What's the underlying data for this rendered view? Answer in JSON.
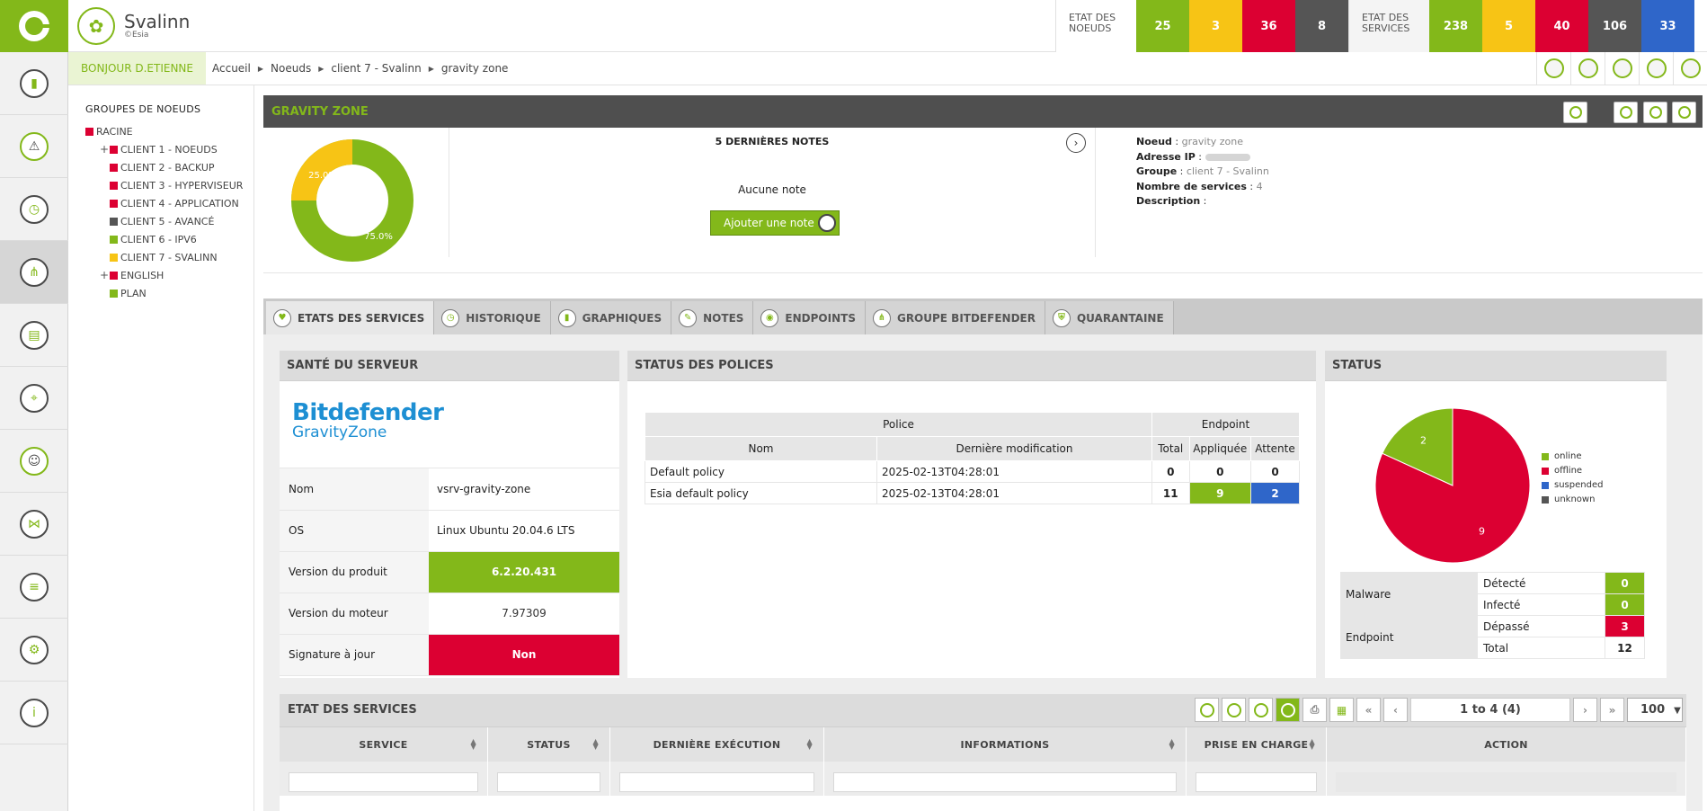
{
  "app": {
    "name": "Svalinn",
    "sub": "©Esia"
  },
  "etat_noeuds": {
    "label": "ETAT DES NOEUDS",
    "counts": [
      "25",
      "3",
      "36",
      "8"
    ]
  },
  "etat_services": {
    "label": "ETAT DES SERVICES",
    "counts": [
      "238",
      "5",
      "40",
      "106",
      "33"
    ]
  },
  "colors": {
    "ok": "#83b81a",
    "warn": "#f7c415",
    "crit": "#dc0032",
    "unknown": "#555555",
    "blue": "#2f66c9"
  },
  "greeting": "BONJOUR D.ETIENNE",
  "breadcrumb": [
    "Accueil",
    "Noeuds",
    "client 7 - Svalinn",
    "gravity zone"
  ],
  "tree": {
    "title": "GROUPES DE NOEUDS",
    "root": "RACINE",
    "items": [
      "CLIENT 1 - NOEUDS",
      "CLIENT 2 - BACKUP",
      "CLIENT 3 - HYPERVISEUR",
      "CLIENT 4 - APPLICATION",
      "CLIENT 5 - AVANCÉ",
      "CLIENT 6 - IPV6",
      "CLIENT 7 - SVALINN",
      "ENGLISH",
      "PLAN"
    ]
  },
  "node": {
    "title": "GRAVITY ZONE",
    "donut": {
      "ok_pct": 75,
      "warn_pct": 25,
      "ok_label": "75.0%",
      "warn_label": "25.0%"
    },
    "notes": {
      "title": "5 DERNIÈRES NOTES",
      "empty": "Aucune note",
      "add": "Ajouter une note"
    },
    "info": {
      "noeud_k": "Noeud",
      "noeud_v": "gravity zone",
      "ip_k": "Adresse IP",
      "groupe_k": "Groupe",
      "groupe_v": "client 7 - Svalinn",
      "services_k": "Nombre de services",
      "services_v": "4",
      "desc_k": "Description"
    }
  },
  "tabs": [
    "ETATS DES SERVICES",
    "HISTORIQUE",
    "GRAPHIQUES",
    "NOTES",
    "ENDPOINTS",
    "GROUPE BITDEFENDER",
    "QUARANTAINE"
  ],
  "sante": {
    "title": "SANTÉ DU SERVEUR",
    "brand1": "Bitdefender",
    "brand2": "GravityZone",
    "rows": [
      {
        "k": "Nom",
        "v": "vsrv-gravity-zone"
      },
      {
        "k": "OS",
        "v": "Linux Ubuntu 20.04.6 LTS"
      },
      {
        "k": "Version du produit",
        "v": "6.2.20.431"
      },
      {
        "k": "Version du moteur",
        "v": "7.97309"
      },
      {
        "k": "Signature à jour",
        "v": "Non"
      }
    ]
  },
  "polices": {
    "title": "STATUS DES POLICES",
    "group_police": "Police",
    "group_endpoint": "Endpoint",
    "headers": [
      "Nom",
      "Dernière modification",
      "Total",
      "Appliquée",
      "Attente"
    ],
    "rows": [
      {
        "nom": "Default policy",
        "date": "2025-02-13T04:28:01",
        "total": "0",
        "appliquee": "0",
        "attente": "0"
      },
      {
        "nom": "Esia default policy",
        "date": "2025-02-13T04:28:01",
        "total": "11",
        "appliquee": "9",
        "attente": "2"
      }
    ]
  },
  "status": {
    "title": "STATUS",
    "chart_data": {
      "type": "pie",
      "categories": [
        "online",
        "offline",
        "suspended",
        "unknown"
      ],
      "values": [
        2,
        9,
        0,
        0
      ],
      "colors": [
        "#83b81a",
        "#dc0032",
        "#2f66c9",
        "#555555"
      ],
      "legend": "right"
    },
    "table": {
      "malware": "Malware",
      "endpoint": "Endpoint",
      "rows": [
        {
          "k": "Détecté",
          "v": "0"
        },
        {
          "k": "Infecté",
          "v": "0"
        },
        {
          "k": "Dépassé",
          "v": "3"
        },
        {
          "k": "Total",
          "v": "12"
        }
      ]
    }
  },
  "services_table": {
    "title": "ETAT DES SERVICES",
    "pager": "1 to 4 (4)",
    "page_size": "100",
    "columns": [
      "SERVICE",
      "STATUS",
      "DERNIÈRE EXÉCUTION",
      "INFORMATIONS",
      "PRISE EN CHARGE",
      "ACTION"
    ]
  }
}
